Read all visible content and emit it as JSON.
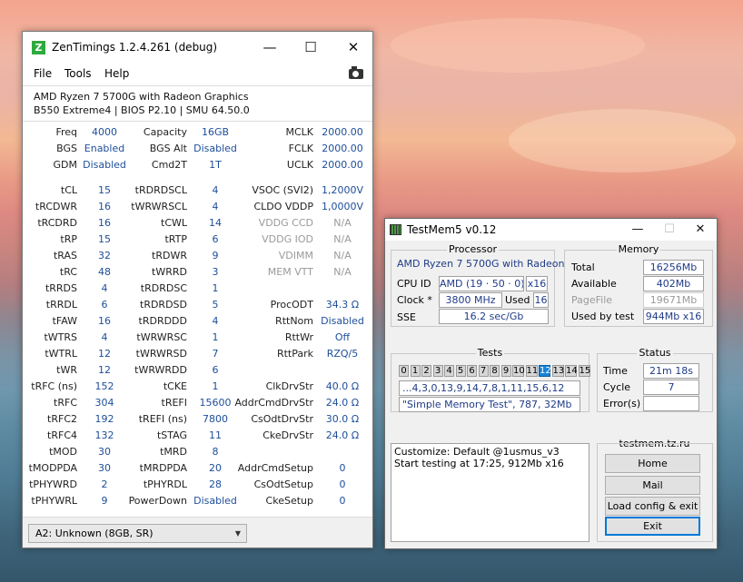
{
  "zentimings": {
    "title": "ZenTimings 1.2.4.261 (debug)",
    "logo_letter": "Z",
    "window_controls": {
      "minimize": "—",
      "maximize": "☐",
      "close": "✕"
    },
    "menu": [
      "File",
      "Tools",
      "Help"
    ],
    "cpu": "AMD Ryzen 7 5700G with Radeon Graphics",
    "board": "B550 Extreme4 | BIOS P2.10 | SMU 64.50.0",
    "rows": [
      [
        {
          "l": "Freq",
          "v": "4000"
        },
        {
          "l": "Capacity",
          "v": "16GB"
        },
        {
          "l": "MCLK",
          "v": "2000.00"
        }
      ],
      [
        {
          "l": "BGS",
          "v": "Enabled"
        },
        {
          "l": "BGS Alt",
          "v": "Disabled"
        },
        {
          "l": "FCLK",
          "v": "2000.00"
        }
      ],
      [
        {
          "l": "GDM",
          "v": "Disabled"
        },
        {
          "l": "Cmd2T",
          "v": "1T"
        },
        {
          "l": "UCLK",
          "v": "2000.00"
        }
      ],
      [
        {
          "l": "tCL",
          "v": "15"
        },
        {
          "l": "tRDRDSCL",
          "v": "4"
        },
        {
          "l": "VSOC (SVI2)",
          "v": "1,2000V"
        }
      ],
      [
        {
          "l": "tRCDWR",
          "v": "16"
        },
        {
          "l": "tWRWRSCL",
          "v": "4"
        },
        {
          "l": "CLDO VDDP",
          "v": "1,0000V"
        }
      ],
      [
        {
          "l": "tRCDRD",
          "v": "16"
        },
        {
          "l": "tCWL",
          "v": "14"
        },
        {
          "l": "VDDG CCD",
          "v": "N/A"
        }
      ],
      [
        {
          "l": "tRP",
          "v": "15"
        },
        {
          "l": "tRTP",
          "v": "6"
        },
        {
          "l": "VDDG IOD",
          "v": "N/A"
        }
      ],
      [
        {
          "l": "tRAS",
          "v": "32"
        },
        {
          "l": "tRDWR",
          "v": "9"
        },
        {
          "l": "VDIMM",
          "v": "N/A"
        }
      ],
      [
        {
          "l": "tRC",
          "v": "48"
        },
        {
          "l": "tWRRD",
          "v": "3"
        },
        {
          "l": "MEM VTT",
          "v": "N/A"
        }
      ],
      [
        {
          "l": "tRRDS",
          "v": "4"
        },
        {
          "l": "tRDRDSC",
          "v": "1"
        },
        {
          "l": "",
          "v": ""
        }
      ],
      [
        {
          "l": "tRRDL",
          "v": "6"
        },
        {
          "l": "tRDRDSD",
          "v": "5"
        },
        {
          "l": "ProcODT",
          "v": "34.3 Ω"
        }
      ],
      [
        {
          "l": "tFAW",
          "v": "16"
        },
        {
          "l": "tRDRDDD",
          "v": "4"
        },
        {
          "l": "RttNom",
          "v": "Disabled"
        }
      ],
      [
        {
          "l": "tWTRS",
          "v": "4"
        },
        {
          "l": "tWRWRSC",
          "v": "1"
        },
        {
          "l": "RttWr",
          "v": "Off"
        }
      ],
      [
        {
          "l": "tWTRL",
          "v": "12"
        },
        {
          "l": "tWRWRSD",
          "v": "7"
        },
        {
          "l": "RttPark",
          "v": "RZQ/5"
        }
      ],
      [
        {
          "l": "tWR",
          "v": "12"
        },
        {
          "l": "tWRWRDD",
          "v": "6"
        },
        {
          "l": "",
          "v": ""
        }
      ],
      [
        {
          "l": "tRFC (ns)",
          "v": "152"
        },
        {
          "l": "tCKE",
          "v": "1"
        },
        {
          "l": "ClkDrvStr",
          "v": "40.0 Ω"
        }
      ],
      [
        {
          "l": "tRFC",
          "v": "304"
        },
        {
          "l": "tREFI",
          "v": "15600"
        },
        {
          "l": "AddrCmdDrvStr",
          "v": "24.0 Ω"
        }
      ],
      [
        {
          "l": "tRFC2",
          "v": "192"
        },
        {
          "l": "tREFI (ns)",
          "v": "7800"
        },
        {
          "l": "CsOdtDrvStr",
          "v": "30.0 Ω"
        }
      ],
      [
        {
          "l": "tRFC4",
          "v": "132"
        },
        {
          "l": "tSTAG",
          "v": "11"
        },
        {
          "l": "CkeDrvStr",
          "v": "24.0 Ω"
        }
      ],
      [
        {
          "l": "tMOD",
          "v": "30"
        },
        {
          "l": "tMRD",
          "v": "8"
        },
        {
          "l": "",
          "v": ""
        }
      ],
      [
        {
          "l": "tMODPDA",
          "v": "30"
        },
        {
          "l": "tMRDPDA",
          "v": "20"
        },
        {
          "l": "AddrCmdSetup",
          "v": "0"
        }
      ],
      [
        {
          "l": "tPHYWRD",
          "v": "2"
        },
        {
          "l": "tPHYRDL",
          "v": "28"
        },
        {
          "l": "CsOdtSetup",
          "v": "0"
        }
      ],
      [
        {
          "l": "tPHYWRL",
          "v": "9"
        },
        {
          "l": "PowerDown",
          "v": "Disabled"
        },
        {
          "l": "CkeSetup",
          "v": "0"
        }
      ]
    ],
    "dimm_select": "A2: Unknown (8GB, SR)"
  },
  "testmem": {
    "title": "TestMem5 v0.12",
    "processor": {
      "group_title": "Processor",
      "name": "AMD Ryzen 7 5700G with Radeon",
      "cpu_id_label": "CPU ID",
      "cpu_id_value": "AMD  (19 · 50 · 0)",
      "threads": "x16",
      "clock_label": "Clock *",
      "clock_value": "3800 MHz",
      "used_label": "Used",
      "used_value": "16",
      "sse_label": "SSE",
      "sse_value": "16.2 sec/Gb"
    },
    "memory": {
      "group_title": "Memory",
      "total_label": "Total",
      "total_value": "16256Mb",
      "available_label": "Available",
      "available_value": "402Mb",
      "pagefile_label": "PageFile",
      "pagefile_value": "19671Mb",
      "used_label": "Used by test",
      "used_value": "944Mb x16"
    },
    "tests": {
      "group_title": "Tests",
      "cells": [
        "0",
        "1",
        "2",
        "3",
        "4",
        "5",
        "6",
        "7",
        "8",
        "9",
        "10",
        "11",
        "12",
        "13",
        "14",
        "15"
      ],
      "active_index": 12,
      "sequence": "...4,3,0,13,9,14,7,8,1,11,15,6,12",
      "current": "\"Simple Memory Test\", 787, 32Mb"
    },
    "status": {
      "group_title": "Status",
      "time_label": "Time",
      "time_value": "21m 18s",
      "cycle_label": "Cycle",
      "cycle_value": "7",
      "errors_label": "Error(s)",
      "errors_value": ""
    },
    "log": [
      "Customize: Default @1usmus_v3",
      "Start testing at 17:25, 912Mb x16"
    ],
    "site": "testmem.tz.ru",
    "buttons": {
      "home": "Home",
      "mail": "Mail",
      "load": "Load config & exit",
      "exit": "Exit"
    }
  }
}
